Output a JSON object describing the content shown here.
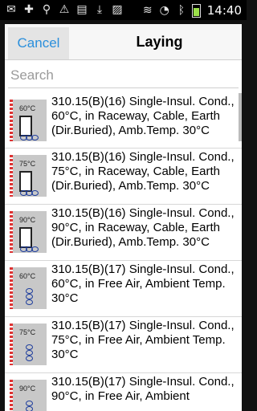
{
  "status_bar": {
    "time": "14:40",
    "icons_left": [
      "mail-icon",
      "plus-icon",
      "usb-icon",
      "warning-icon",
      "sd-card-icon",
      "download-icon",
      "image-icon"
    ],
    "icons_right": [
      "signal-icon",
      "wifi-icon",
      "bluetooth-icon",
      "battery-icon"
    ]
  },
  "dialog": {
    "cancel_label": "Cancel",
    "title": "Laying",
    "search_placeholder": "Search"
  },
  "items": [
    {
      "temp": "60°C",
      "type": "raceway",
      "text": "310.15(B)(16) Single-Insul. Cond., 60°C, in Raceway, Cable, Earth (Dir.Buried), Amb.Temp. 30°C"
    },
    {
      "temp": "75°C",
      "type": "raceway",
      "text": "310.15(B)(16) Single-Insul. Cond., 75°C, in Raceway, Cable, Earth (Dir.Buried), Amb.Temp. 30°C"
    },
    {
      "temp": "90°C",
      "type": "raceway",
      "text": "310.15(B)(16) Single-Insul. Cond., 90°C, in Raceway, Cable, Earth (Dir.Buried), Amb.Temp. 30°C"
    },
    {
      "temp": "60°C",
      "type": "free-air",
      "text": "310.15(B)(17) Single-Insul. Cond., 60°C, in Free Air, Ambient Temp. 30°C"
    },
    {
      "temp": "75°C",
      "type": "free-air",
      "text": "310.15(B)(17) Single-Insul. Cond., 75°C, in Free Air, Ambient Temp. 30°C"
    },
    {
      "temp": "90°C",
      "type": "free-air",
      "text": "310.15(B)(17) Single-Insul. Cond., 90°C, in Free Air, Ambient"
    }
  ]
}
